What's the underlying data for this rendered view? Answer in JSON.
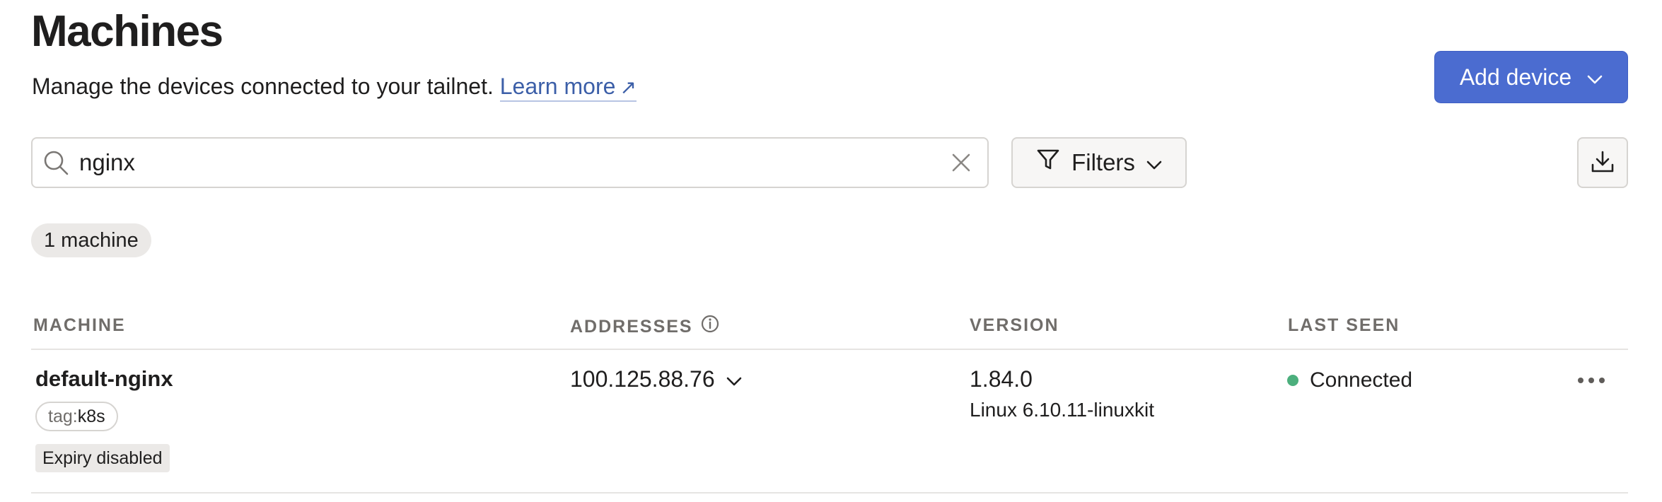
{
  "header": {
    "title": "Machines",
    "subtitle": "Manage the devices connected to your tailnet.",
    "learn_more": "Learn more"
  },
  "actions": {
    "add_device": "Add device",
    "filters": "Filters"
  },
  "search": {
    "value": "nginx",
    "icon": "search-icon"
  },
  "summary": {
    "count_label": "1 machine"
  },
  "table": {
    "columns": [
      "MACHINE",
      "ADDRESSES",
      "VERSION",
      "LAST SEEN"
    ],
    "rows": [
      {
        "name": "default-nginx",
        "tag_prefix": "tag:",
        "tag_value": "k8s",
        "expiry": "Expiry disabled",
        "address": "100.125.88.76",
        "version": "1.84.0",
        "os": "Linux 6.10.11-linuxkit",
        "last_seen": "Connected"
      }
    ]
  },
  "colors": {
    "accent": "#4b6cd0",
    "link": "#3c5fa8",
    "connected": "#4caf7d"
  }
}
